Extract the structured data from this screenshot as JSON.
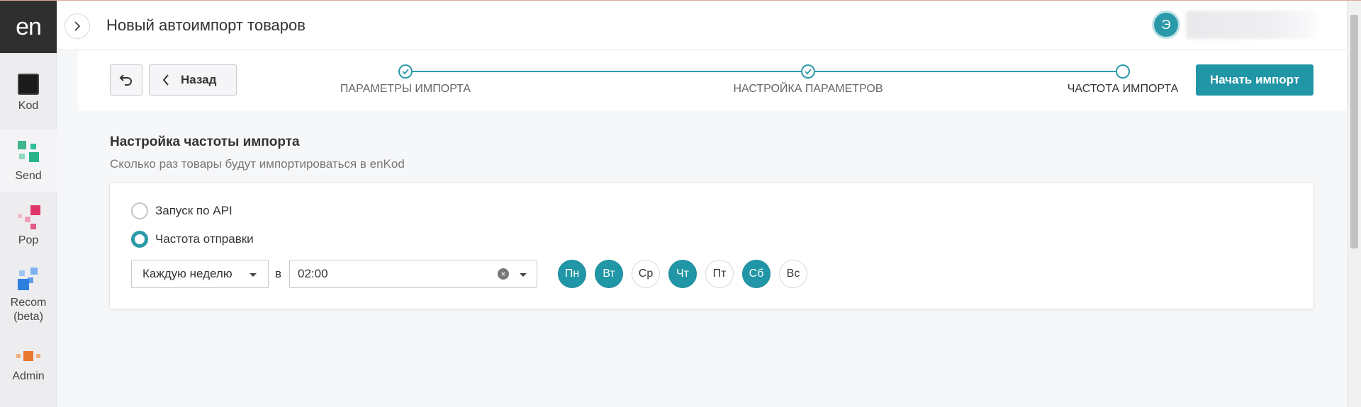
{
  "sidebar": {
    "logo": "en",
    "items": [
      {
        "label": "Kod",
        "icon": "kod-icon"
      },
      {
        "label": "Send",
        "icon": "send-icon"
      },
      {
        "label": "Pop",
        "icon": "pop-icon"
      },
      {
        "label": "Recom",
        "label2": "(beta)",
        "icon": "recom-icon"
      },
      {
        "label": "Admin",
        "icon": "admin-icon"
      }
    ]
  },
  "header": {
    "title": "Новый автоимпорт товаров",
    "avatar_initial": "Э"
  },
  "wizard": {
    "back_label": "Назад",
    "steps": [
      {
        "label": "ПАРАМЕТРЫ ИМПОРТА",
        "state": "done"
      },
      {
        "label": "НАСТРОЙКА ПАРАМЕТРОВ",
        "state": "done"
      },
      {
        "label": "ЧАСТОТА ИМПОРТА",
        "state": "current"
      }
    ],
    "start_label": "Начать импорт"
  },
  "content": {
    "title": "Настройка частоты импорта",
    "subtitle": "Сколько раз товары будут импортироваться в enKod",
    "options": [
      {
        "label": "Запуск по API",
        "checked": false
      },
      {
        "label": "Частота отправки",
        "checked": true
      }
    ],
    "period_value": "Каждую неделю",
    "at_label": "в",
    "time_value": "02:00",
    "days": [
      {
        "label": "Пн",
        "on": true
      },
      {
        "label": "Вт",
        "on": true
      },
      {
        "label": "Ср",
        "on": false
      },
      {
        "label": "Чт",
        "on": true
      },
      {
        "label": "Пт",
        "on": false
      },
      {
        "label": "Сб",
        "on": true
      },
      {
        "label": "Вс",
        "on": false
      }
    ]
  },
  "colors": {
    "accent": "#2196a6",
    "logo_bg": "#2f2f2f"
  }
}
